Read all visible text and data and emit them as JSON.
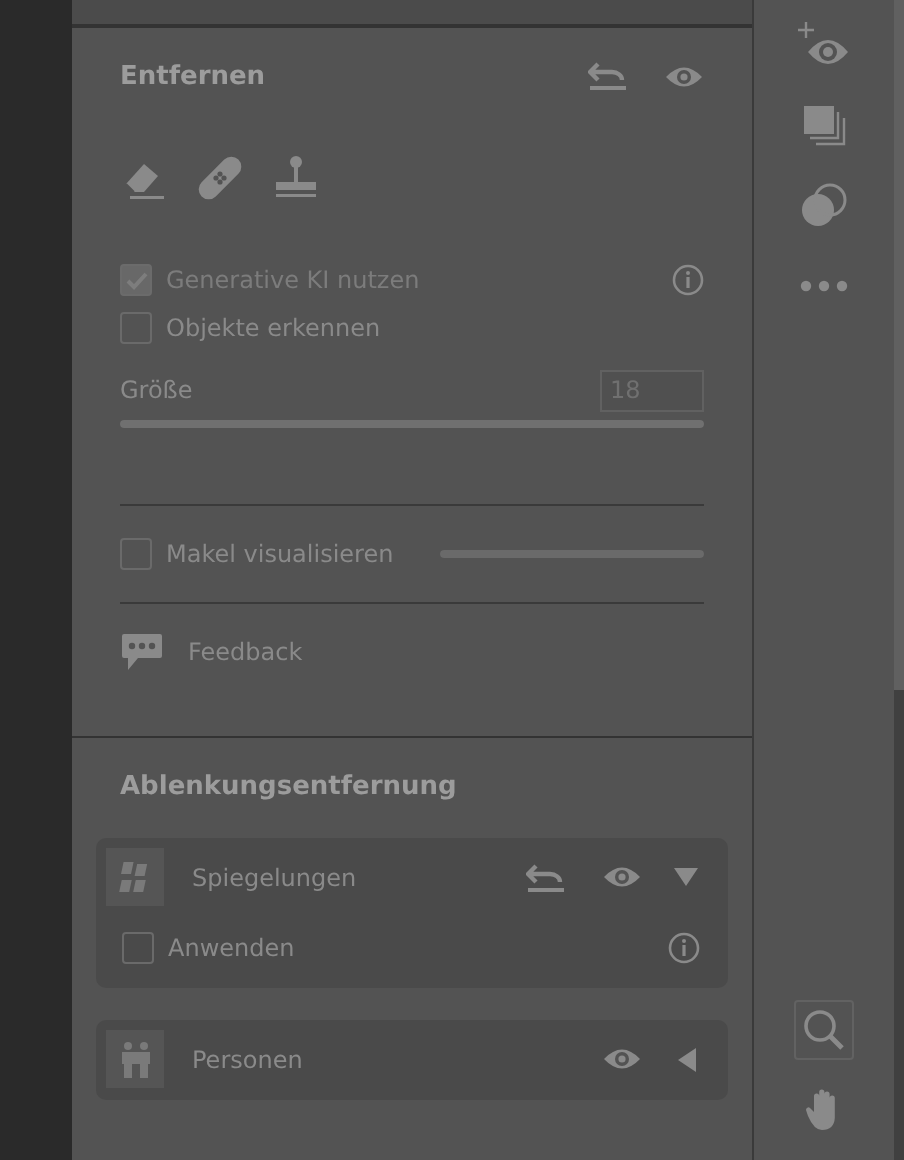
{
  "remove": {
    "title": "Entfernen",
    "tools": [
      {
        "kind": "eraser"
      },
      {
        "kind": "bandage"
      },
      {
        "kind": "stamp"
      }
    ],
    "options": [
      {
        "label": "Generative KI nutzen",
        "checked": true,
        "disabled": true,
        "info": true
      },
      {
        "label": "Objekte erkennen",
        "checked": false,
        "disabled": false,
        "info": false
      }
    ],
    "size": {
      "label": "Größe",
      "value": "18",
      "level": 1
    },
    "visualize": {
      "label": "Makel visualisieren",
      "checked": false,
      "level": 1
    },
    "feedback": "Feedback"
  },
  "distraction": {
    "title": "Ablenkungsentfernung",
    "items": [
      {
        "kind": "reflections",
        "label": "Spiegelungen",
        "reset": true,
        "expanded": true,
        "options": [
          {
            "label": "Anwenden",
            "checked": false
          }
        ]
      },
      {
        "kind": "people",
        "label": "Personen",
        "reset": false,
        "expanded": false
      }
    ]
  },
  "toolbar": [
    {
      "kind": "eye-plus",
      "selected": false
    },
    {
      "kind": "layers",
      "selected": false
    },
    {
      "kind": "blend",
      "selected": false
    },
    {
      "kind": "more",
      "selected": false
    },
    {
      "kind": "search",
      "selected": true
    },
    {
      "kind": "hand",
      "selected": false
    }
  ]
}
